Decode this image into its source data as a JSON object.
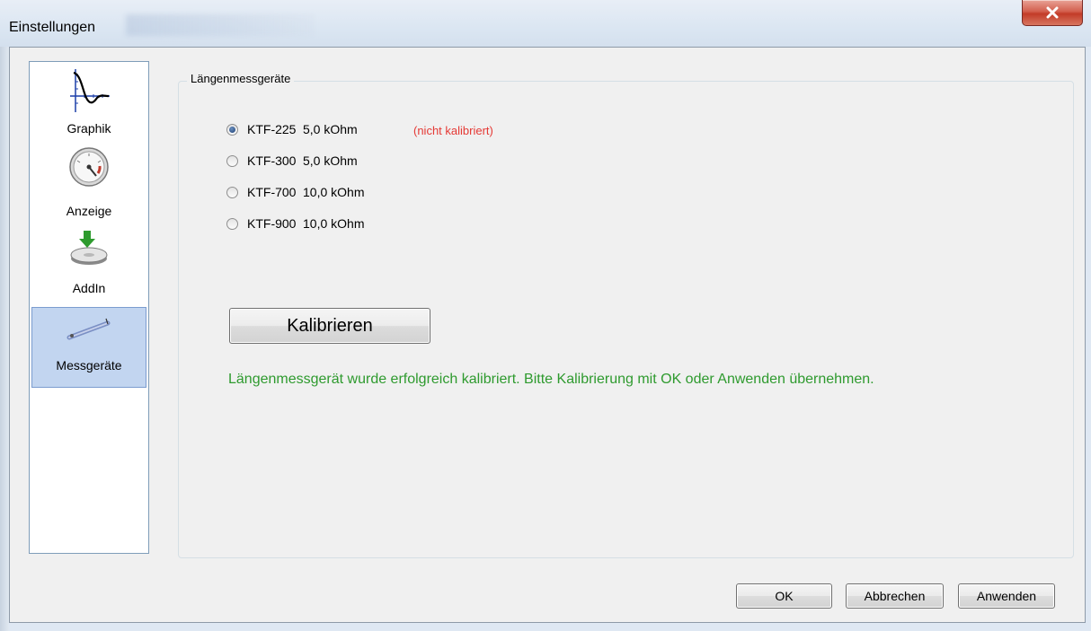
{
  "window": {
    "title": "Einstellungen",
    "close_symbol": "x"
  },
  "sidebar": {
    "items": [
      {
        "label": "Graphik",
        "icon": "graph-curve-icon"
      },
      {
        "label": "Anzeige",
        "icon": "gauge-icon"
      },
      {
        "label": "AddIn",
        "icon": "addin-download-icon"
      },
      {
        "label": "Messgeräte",
        "icon": "measuring-device-icon",
        "selected": true
      }
    ]
  },
  "group": {
    "title": "Längenmessgeräte",
    "options": [
      {
        "name": "KTF-225",
        "value": "5,0 kOhm",
        "checked": true
      },
      {
        "name": "KTF-300",
        "value": "5,0 kOhm",
        "checked": false
      },
      {
        "name": "KTF-700",
        "value": "10,0 kOhm",
        "checked": false
      },
      {
        "name": "KTF-900",
        "value": "10,0 kOhm",
        "checked": false
      }
    ],
    "note": "(nicht kalibriert)",
    "calibrate_label": "Kalibrieren",
    "status": "Längenmessgerät wurde erfolgreich kalibriert. Bitte Kalibrierung mit OK oder Anwenden übernehmen."
  },
  "footer": {
    "ok_label": "OK",
    "cancel_label": "Abbrechen",
    "apply_label": "Anwenden"
  },
  "colors": {
    "note_red": "#e53935",
    "status_green": "#2e9a2e",
    "selected_bg": "#c2d5f0"
  }
}
